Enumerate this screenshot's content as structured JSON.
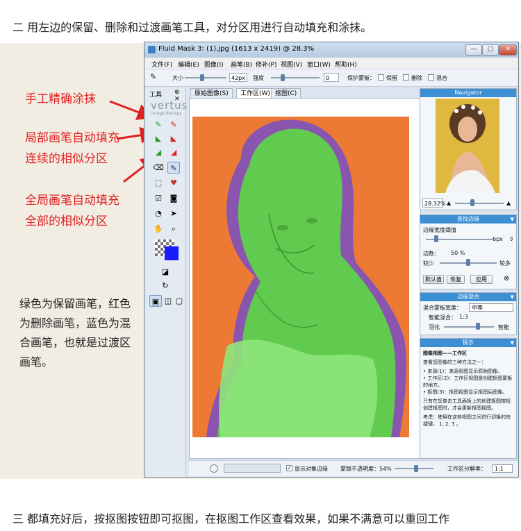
{
  "article": {
    "heading1": "二 用左边的保留、删除和过渡画笔工具，对分区用进行自动填充和涂抹。",
    "heading3": "三 都填充好后，按抠图按钮即可抠图，在抠图工作区查看效果，如果不满意可以重回工作",
    "annotations": {
      "manual": "手工精确涂抹",
      "local1": "局部画笔自动填充",
      "local2": "连续的相似分区",
      "global1": "全局画笔自动填充",
      "global2": "全部的相似分区"
    },
    "note": "绿色为保留画笔，红色为删除画笔，蓝色为混合画笔，也就是过渡区画笔。",
    "colors": {
      "annotation": "#e02020",
      "keep_brush": "#5fd24a",
      "blend_brush": "#6a4ad8",
      "background": "#ec7a35"
    }
  },
  "window": {
    "title": "Fluid Mask 3: (1).jpg (1613 x 2419) @ 28.3%",
    "controls": {
      "minimize": "—",
      "maximize": "□",
      "close": "✕"
    },
    "menu": [
      "文件(F)",
      "编辑(E)",
      "图像(I)",
      "画笔(B)",
      "修补(P)",
      "视图(V)",
      "窗口(W)",
      "帮助(H)"
    ],
    "toolbar": {
      "size_label": "大小",
      "size_value": "42px",
      "soft_label": "强度",
      "soft_value": "0",
      "protect_label": "保护蒙板：",
      "keep_label": "保留",
      "delete_label": "删除",
      "blend_label": "混合"
    },
    "tools_panel": {
      "title": "工具",
      "pin": "⊕ ✕",
      "logo": "vertus",
      "logo_sub": "image therapy"
    },
    "tabs": [
      "原始图像(S)",
      "工作区(W)",
      "抠图(C)"
    ],
    "active_tab": 1,
    "status": {
      "show_edges_label": "显示对象边缘",
      "opacity_label": "蒙版不透明度：54%",
      "resolution_label": "工作区分解率：",
      "resolution_value": "1:1"
    },
    "navigator": {
      "title": "Navigator",
      "zoom": "28.32%"
    },
    "find_edges": {
      "title": "查找边缘",
      "threshold_label": "边缘宽度阈值",
      "threshold_value": "6px",
      "edge_label": "边数：",
      "edge_value": "50 %",
      "less_label": "较少",
      "more_label": "较多",
      "btn_default": "默认值",
      "btn_restore": "恢复",
      "btn_apply": "应用"
    },
    "edge_blend": {
      "title": "边缘混合",
      "width_label": "混合蒙板宽度：",
      "width_value": "中等",
      "smart_label": "智能混合：",
      "smart_value": "1:3",
      "feather_label": "羽化",
      "smart2_label": "智能"
    },
    "help": {
      "title": "提示",
      "heading": "图像视图——工作区",
      "intro": "查看您图像的三种方法之一：",
      "item1": "• 来源(1)：来源视图显示原始图像。",
      "item2": "• 工作区(2)：工作区视图是创建抠图蒙板的地方。",
      "item3": "• 抠图(3)：抠图视图显示抠图后图像。",
      "para": "只有在您单击工具面板上的创建抠图按钮创建抠图时，才会更新抠图视图。",
      "tip": "考虑：使用在这些视图之间进行切换的快捷键。 1, 2, 3 。"
    }
  }
}
